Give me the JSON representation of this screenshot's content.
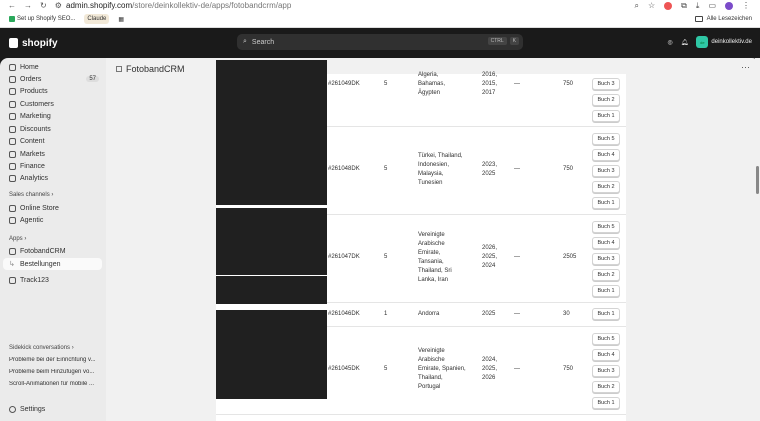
{
  "browser": {
    "url_host": "admin.shopify.com",
    "url_path": "/store/deinkollektiv-de/apps/fotobandcrm/app",
    "bookmarks": [
      {
        "label": "Set up Shopify SEO..."
      },
      {
        "label": "Claude"
      }
    ],
    "bookmarks_folder": "Alle Lesezeichen"
  },
  "topbar": {
    "logo": "shopify",
    "search_placeholder": "Search",
    "kbd1": "CTRL",
    "kbd2": "K",
    "store_name": "deinkollektiv.de",
    "store_initials": "de"
  },
  "sidebar": {
    "items": [
      {
        "label": "Home",
        "icon": "home-icon"
      },
      {
        "label": "Orders",
        "icon": "orders-icon",
        "badge": "57"
      },
      {
        "label": "Products",
        "icon": "products-icon"
      },
      {
        "label": "Customers",
        "icon": "customers-icon"
      },
      {
        "label": "Marketing",
        "icon": "marketing-icon"
      },
      {
        "label": "Discounts",
        "icon": "discounts-icon"
      },
      {
        "label": "Content",
        "icon": "content-icon"
      },
      {
        "label": "Markets",
        "icon": "markets-icon"
      },
      {
        "label": "Finance",
        "icon": "finance-icon"
      },
      {
        "label": "Analytics",
        "icon": "analytics-icon"
      }
    ],
    "sales_channels_heading": "Sales channels",
    "sales_channels": [
      {
        "label": "Online Store"
      },
      {
        "label": "Agentic"
      }
    ],
    "apps_heading": "Apps",
    "apps": [
      {
        "label": "FotobandCRM"
      },
      {
        "label": "Bestellungen"
      },
      {
        "label": "Track123"
      }
    ],
    "sidekick_heading": "Sidekick conversations",
    "conversations": [
      "Probleme bei der Einrichtung v...",
      "Probleme beim Hinzufügen vo...",
      "Scroll-Animationen für mobile ..."
    ],
    "settings": "Settings"
  },
  "main": {
    "title": "FotobandCRM",
    "rows": [
      {
        "id": "#261049DK",
        "qty": "5",
        "countries": [
          "Algeria,",
          "Bahamas,",
          "Ägypten"
        ],
        "years": [
          "2016,",
          "2015,",
          "2017"
        ],
        "dash": "—",
        "price": "750",
        "buttons": [
          "Buch 3",
          "Buch 2",
          "Buch 1"
        ]
      },
      {
        "id": "#261048DK",
        "qty": "5",
        "countries": [
          "Türkei, Thailand,",
          "Indonesien,",
          "Malaysia,",
          "Tunesien"
        ],
        "years": [
          "2023,",
          "2025"
        ],
        "dash": "—",
        "price": "750",
        "buttons": [
          "Buch 5",
          "Buch 4",
          "Buch 3",
          "Buch 2",
          "Buch 1"
        ]
      },
      {
        "id": "#261047DK",
        "qty": "5",
        "countries": [
          "Vereinigte",
          "Arabische",
          "Emirate,",
          "Tansania,",
          "Thailand, Sri",
          "Lanka, Iran"
        ],
        "years": [
          "2026,",
          "2025,",
          "2024"
        ],
        "dash": "—",
        "price": "2505",
        "buttons": [
          "Buch 5",
          "Buch 4",
          "Buch 3",
          "Buch 2",
          "Buch 1"
        ]
      },
      {
        "id": "#261046DK",
        "qty": "1",
        "countries": [
          "Andorra"
        ],
        "years": [
          "2025"
        ],
        "dash": "—",
        "price": "30",
        "buttons": [
          "Buch 1"
        ]
      },
      {
        "id": "#261045DK",
        "qty": "5",
        "countries": [
          "Vereinigte",
          "Arabische",
          "Emirate, Spanien,",
          "Thailand,",
          "Portugal"
        ],
        "years": [
          "2024,",
          "2025,",
          "2026"
        ],
        "dash": "—",
        "price": "750",
        "buttons": [
          "Buch 5",
          "Buch 4",
          "Buch 3",
          "Buch 2",
          "Buch 1"
        ]
      }
    ]
  }
}
